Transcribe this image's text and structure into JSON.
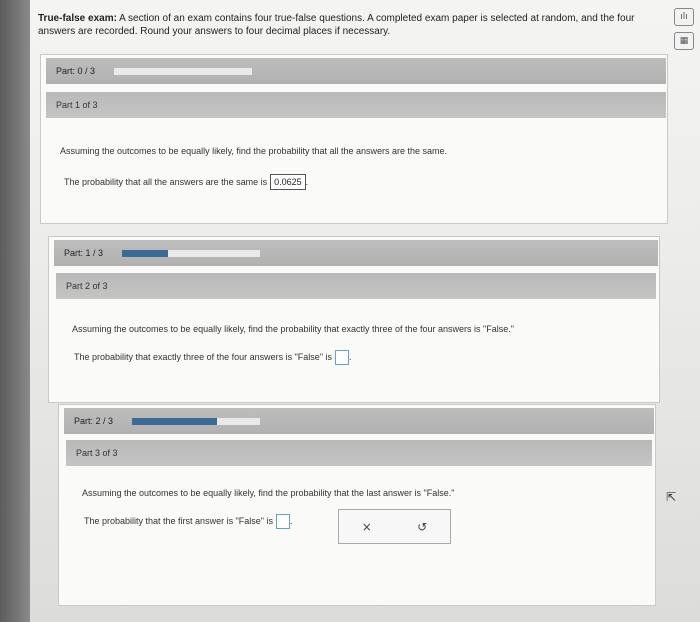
{
  "header": {
    "title": "True-false exam:",
    "text": " A section of an exam contains four true-false questions. A completed exam paper is selected at random, and the four answers are recorded. Round your answers to four decimal places if necessary."
  },
  "side_icons": [
    {
      "name": "chart-icon",
      "glyph": "ılı"
    },
    {
      "name": "calculator-icon",
      "glyph": "▦"
    }
  ],
  "overall": {
    "label": "Part: 0 / 3",
    "progress": 0.0
  },
  "parts": [
    {
      "partof": "Part 1 of 3",
      "question": "Assuming the outcomes to be equally likely, find the probability that all the answers are the same.",
      "answer_prefix": "The probability that all the answers are the same is",
      "answer_value": "0.0625",
      "answer_suffix": "."
    },
    {
      "progress_label": "Part: 1 / 3",
      "progress": 0.333,
      "partof": "Part 2 of 3",
      "question": "Assuming the outcomes to be equally likely, find the probability that exactly three of the four answers is \"False.\"",
      "answer_prefix": "The probability that exactly three of the four answers is \"False\" is",
      "answer_value": "",
      "answer_suffix": "."
    },
    {
      "progress_label": "Part: 2 / 3",
      "progress": 0.667,
      "partof": "Part 3 of 3",
      "question": "Assuming the outcomes to be equally likely, find the probability that the last answer is \"False.\"",
      "answer_prefix": "The probability that the first answer is \"False\" is",
      "answer_value": "",
      "answer_suffix": "."
    }
  ],
  "actions": {
    "clear": "×",
    "reset": "↺"
  }
}
